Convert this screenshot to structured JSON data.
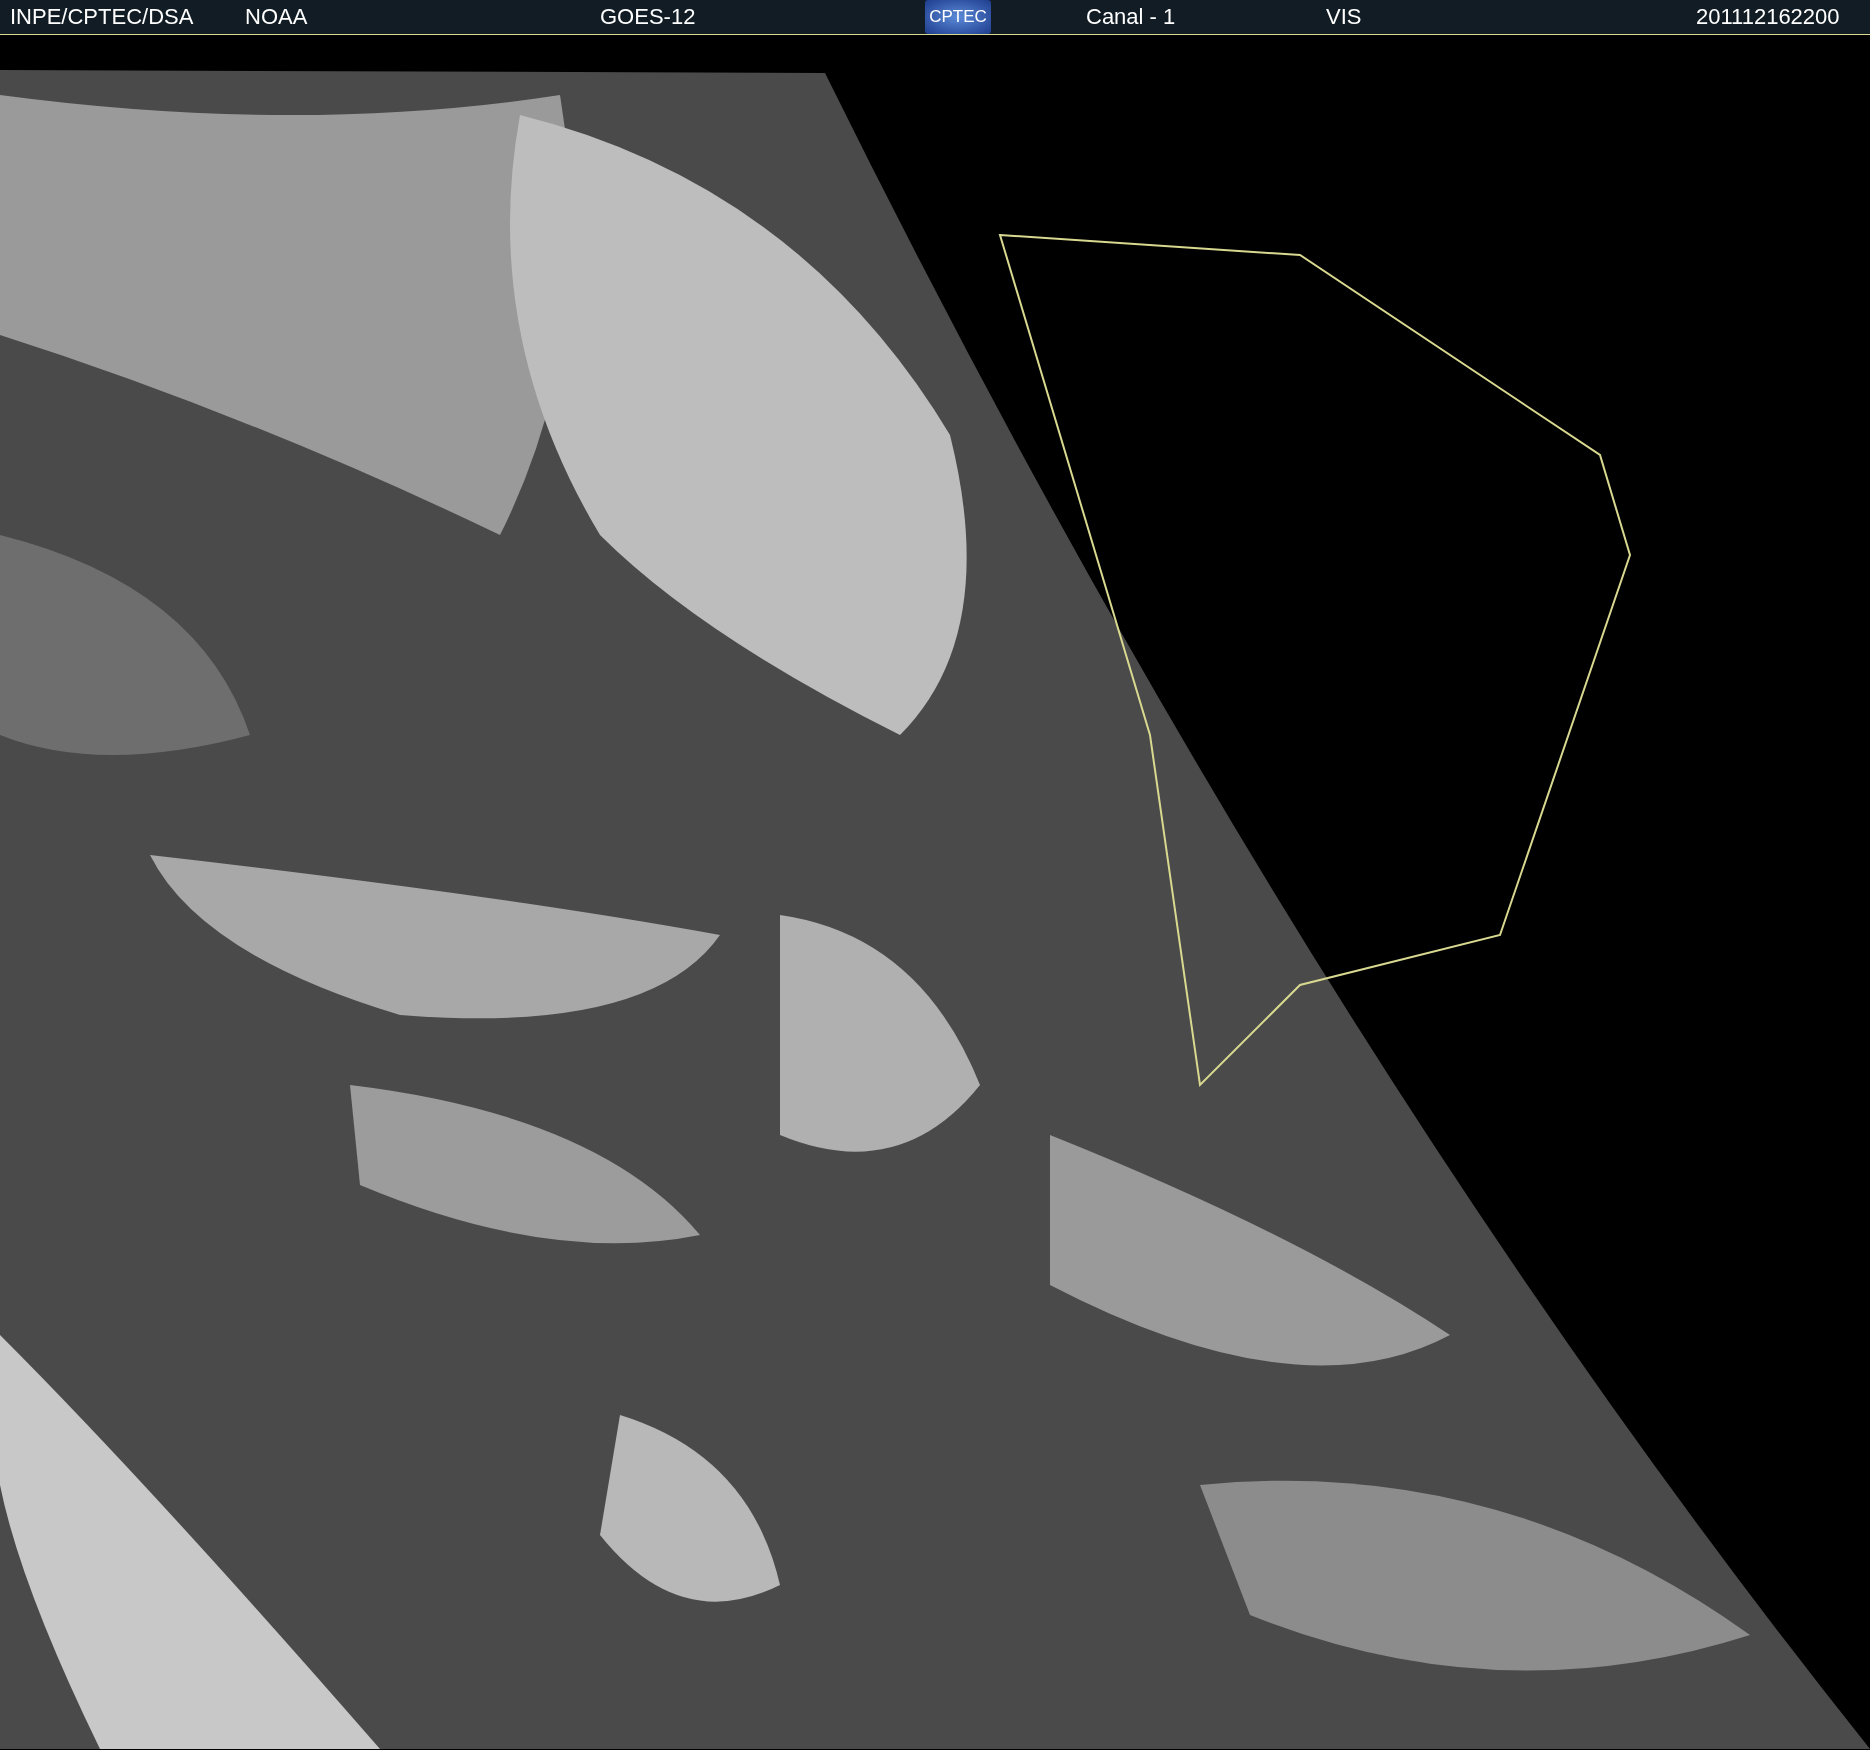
{
  "header": {
    "source": "INPE/CPTEC/DSA",
    "agency": "NOAA",
    "satellite": "GOES-12",
    "logo": "CPTEC",
    "channel": "Canal - 1",
    "band": "VIS",
    "timestamp": "201112162200"
  }
}
